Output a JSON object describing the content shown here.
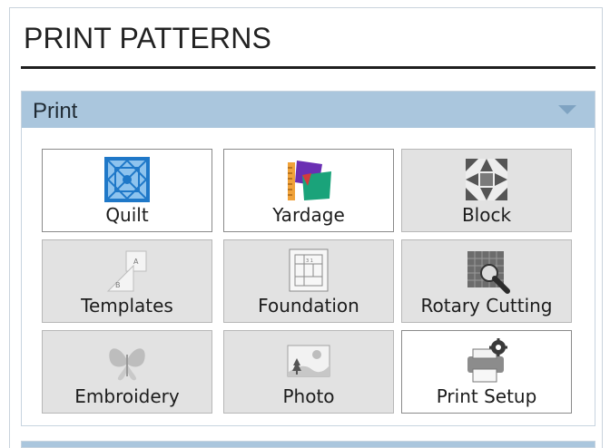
{
  "page": {
    "title": "PRINT PATTERNS"
  },
  "section": {
    "title": "Print",
    "collapse_icon": "triangle-down-icon",
    "tiles": [
      {
        "label": "Quilt",
        "icon": "quilt-icon",
        "state": "enabled"
      },
      {
        "label": "Yardage",
        "icon": "yardage-icon",
        "state": "enabled"
      },
      {
        "label": "Block",
        "icon": "block-icon",
        "state": "disabled"
      },
      {
        "label": "Templates",
        "icon": "templates-icon",
        "state": "disabled"
      },
      {
        "label": "Foundation",
        "icon": "foundation-icon",
        "state": "disabled"
      },
      {
        "label": "Rotary Cutting",
        "icon": "rotary-cutting-icon",
        "state": "disabled"
      },
      {
        "label": "Embroidery",
        "icon": "embroidery-icon",
        "state": "disabled"
      },
      {
        "label": "Photo",
        "icon": "photo-icon",
        "state": "disabled"
      },
      {
        "label": "Print Setup",
        "icon": "printer-settings-icon",
        "state": "enabled"
      }
    ]
  },
  "colors": {
    "header_bg": "#aac6dd",
    "tile_disabled_bg": "#e2e2e2",
    "tile_enabled_bg": "#ffffff",
    "quilt_blue": "#1f78c8"
  }
}
